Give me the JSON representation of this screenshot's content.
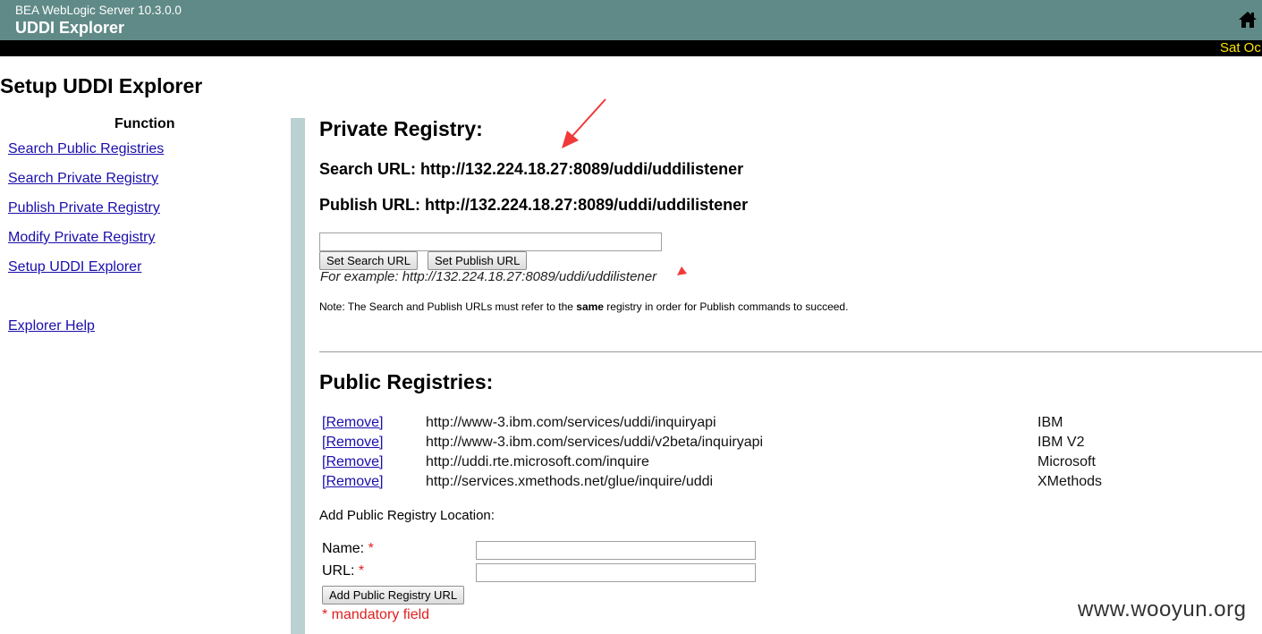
{
  "header": {
    "product": "BEA WebLogic Server 10.3.0.0",
    "app_title": "UDDI Explorer",
    "date": "Sat Oc",
    "home_icon": "home-icon"
  },
  "page": {
    "title": "Setup UDDI Explorer"
  },
  "sidebar": {
    "heading": "Function",
    "items": [
      {
        "label": "Search Public Registries"
      },
      {
        "label": "Search Private Registry"
      },
      {
        "label": "Publish Private Registry"
      },
      {
        "label": "Modify Private Registry"
      },
      {
        "label": "Setup UDDI Explorer"
      }
    ],
    "help": "Explorer Help"
  },
  "private_registry": {
    "heading": "Private Registry:",
    "search_url": "Search URL: http://132.224.18.27:8089/uddi/uddilistener",
    "publish_url": "Publish URL: http://132.224.18.27:8089/uddi/uddilistener",
    "url_input_value": "",
    "set_search_label": "Set Search URL",
    "set_publish_label": "Set Publish URL",
    "example": "For example: http://132.224.18.27:8089/uddi/uddilistener",
    "note_before": "Note: The Search and Publish URLs must refer to the ",
    "note_bold": "same",
    "note_after": " registry in order for Publish commands to succeed."
  },
  "public_registries": {
    "heading": "Public Registries:",
    "remove_label": "[Remove]",
    "rows": [
      {
        "url": "http://www-3.ibm.com/services/uddi/inquiryapi",
        "name": "IBM"
      },
      {
        "url": "http://www-3.ibm.com/services/uddi/v2beta/inquiryapi",
        "name": "IBM V2"
      },
      {
        "url": "http://uddi.rte.microsoft.com/inquire",
        "name": "Microsoft"
      },
      {
        "url": "http://services.xmethods.net/glue/inquire/uddi",
        "name": "XMethods"
      }
    ],
    "add_location_label": "Add Public Registry Location:",
    "name_label": "Name:",
    "url_label": "URL:",
    "required_marker": "*",
    "name_value": "",
    "url_value": "",
    "add_button_label": "Add Public Registry URL",
    "mandatory_note": "* mandatory field"
  },
  "watermark": "www.wooyun.org",
  "colors": {
    "header_bg": "#5f8a87",
    "date_text": "#ffe600",
    "link": "#1a0dab",
    "sidebar_bar": "#b9d1d0",
    "required": "#e02020",
    "annotation_arrow": "#f03a3a"
  }
}
